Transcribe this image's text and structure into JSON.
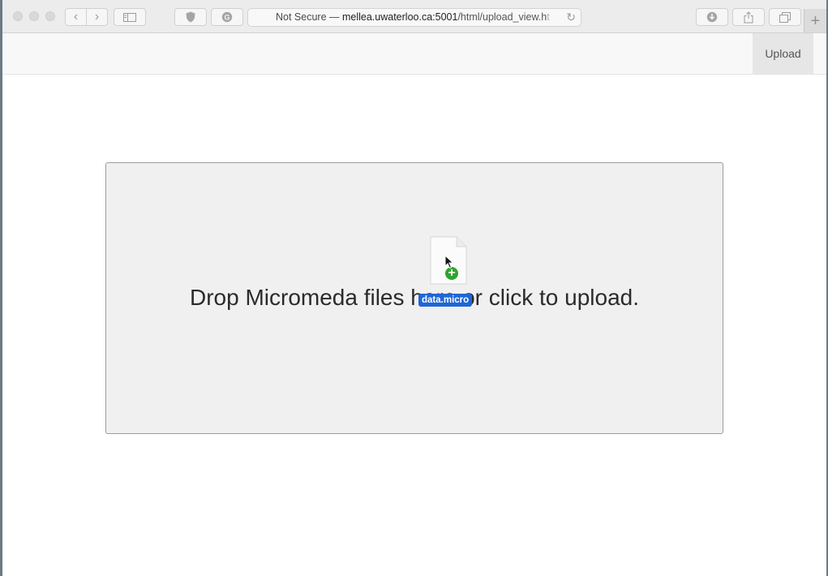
{
  "browser": {
    "address": {
      "prefix": "Not Secure — ",
      "domain": "mellea.uwaterloo.ca:5001",
      "path": "/html/upload_view.h",
      "fade": "t"
    },
    "icons": {
      "back": "‹",
      "forward": "›",
      "reload": "↻",
      "new_tab": "+"
    }
  },
  "navbar": {
    "upload_label": "Upload"
  },
  "dropzone": {
    "message": "Drop Micromeda files here or click to upload."
  },
  "drag": {
    "file_name": "data.micro",
    "badge": "+"
  }
}
